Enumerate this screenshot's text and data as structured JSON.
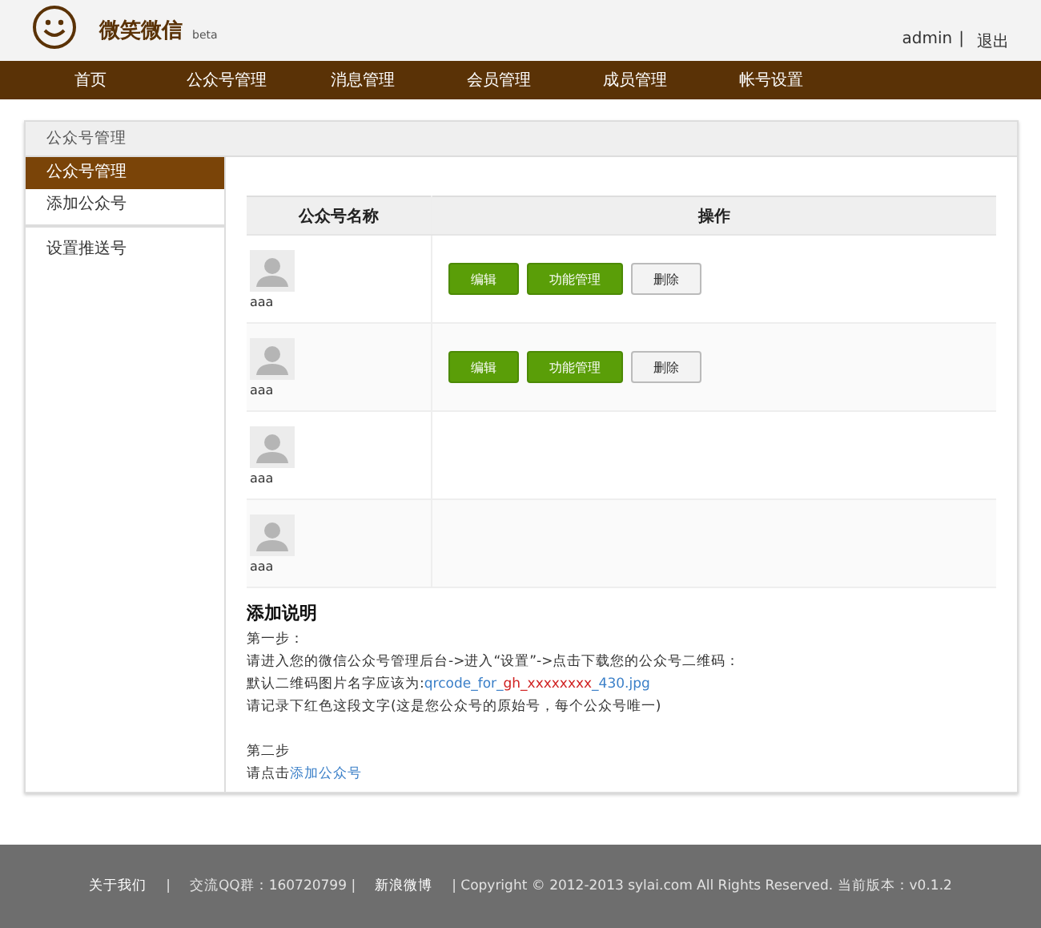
{
  "header": {
    "title": "微笑微信",
    "badge": "beta",
    "user": "admin",
    "separator": "|",
    "logout": "退出"
  },
  "nav": [
    {
      "label": "首页"
    },
    {
      "label": "公众号管理"
    },
    {
      "label": "消息管理"
    },
    {
      "label": "会员管理"
    },
    {
      "label": "成员管理"
    },
    {
      "label": "帐号设置"
    }
  ],
  "panel": {
    "title": "公众号管理"
  },
  "sidebar": {
    "groups": [
      [
        {
          "label": "公众号管理",
          "selected": true
        },
        {
          "label": "添加公众号",
          "selected": false
        }
      ],
      [
        {
          "label": "设置推送号",
          "selected": false
        }
      ]
    ]
  },
  "table": {
    "columns": [
      "公众号名称",
      "操作"
    ],
    "rows": [
      {
        "name": "aaa",
        "actions": [
          {
            "label": "编辑",
            "kind": "primary"
          },
          {
            "label": "功能管理",
            "kind": "primary"
          },
          {
            "label": "删除",
            "kind": "plain"
          }
        ]
      },
      {
        "name": "aaa",
        "actions": [
          {
            "label": "编辑",
            "kind": "primary"
          },
          {
            "label": "功能管理",
            "kind": "primary"
          },
          {
            "label": "删除",
            "kind": "plain"
          }
        ]
      },
      {
        "name": "aaa",
        "actions": []
      },
      {
        "name": "aaa",
        "actions": []
      }
    ]
  },
  "instructions": {
    "title": "添加说明",
    "lines": [
      [
        [
          {
            "kind": "text",
            "text": "第一步："
          }
        ],
        [
          {
            "kind": "text",
            "text": "请进入您的微信公众号管理后台->进入“设置”->点击下载您的公众号二维码："
          }
        ],
        [
          {
            "kind": "text",
            "text": "默认二维码图片名字应该为:"
          },
          {
            "kind": "code",
            "text": "qrcode_for_"
          },
          {
            "kind": "highlight",
            "text": "gh_xxxxxxxx"
          },
          {
            "kind": "code",
            "text": "_430.jpg"
          }
        ],
        [
          {
            "kind": "text",
            "text": "请记录下红色这段文字(这是您公众号的原始号，每个公众号唯一)"
          }
        ]
      ],
      [
        [
          {
            "kind": "text",
            "text": "第二步"
          }
        ],
        [
          {
            "kind": "text",
            "text": "请点击"
          },
          {
            "kind": "link",
            "text": "添加公众号"
          }
        ]
      ]
    ]
  },
  "footer": [
    {
      "kind": "link",
      "text": "关于我们"
    },
    {
      "kind": "text",
      "text": "|"
    },
    {
      "kind": "text",
      "text": "交流QQ群：160720799 |"
    },
    {
      "kind": "link",
      "text": "新浪微博"
    },
    {
      "kind": "text",
      "text": "| Copyright © 2012-2013 sylai.com All Rights Reserved. 当前版本：v0.1.2"
    }
  ]
}
